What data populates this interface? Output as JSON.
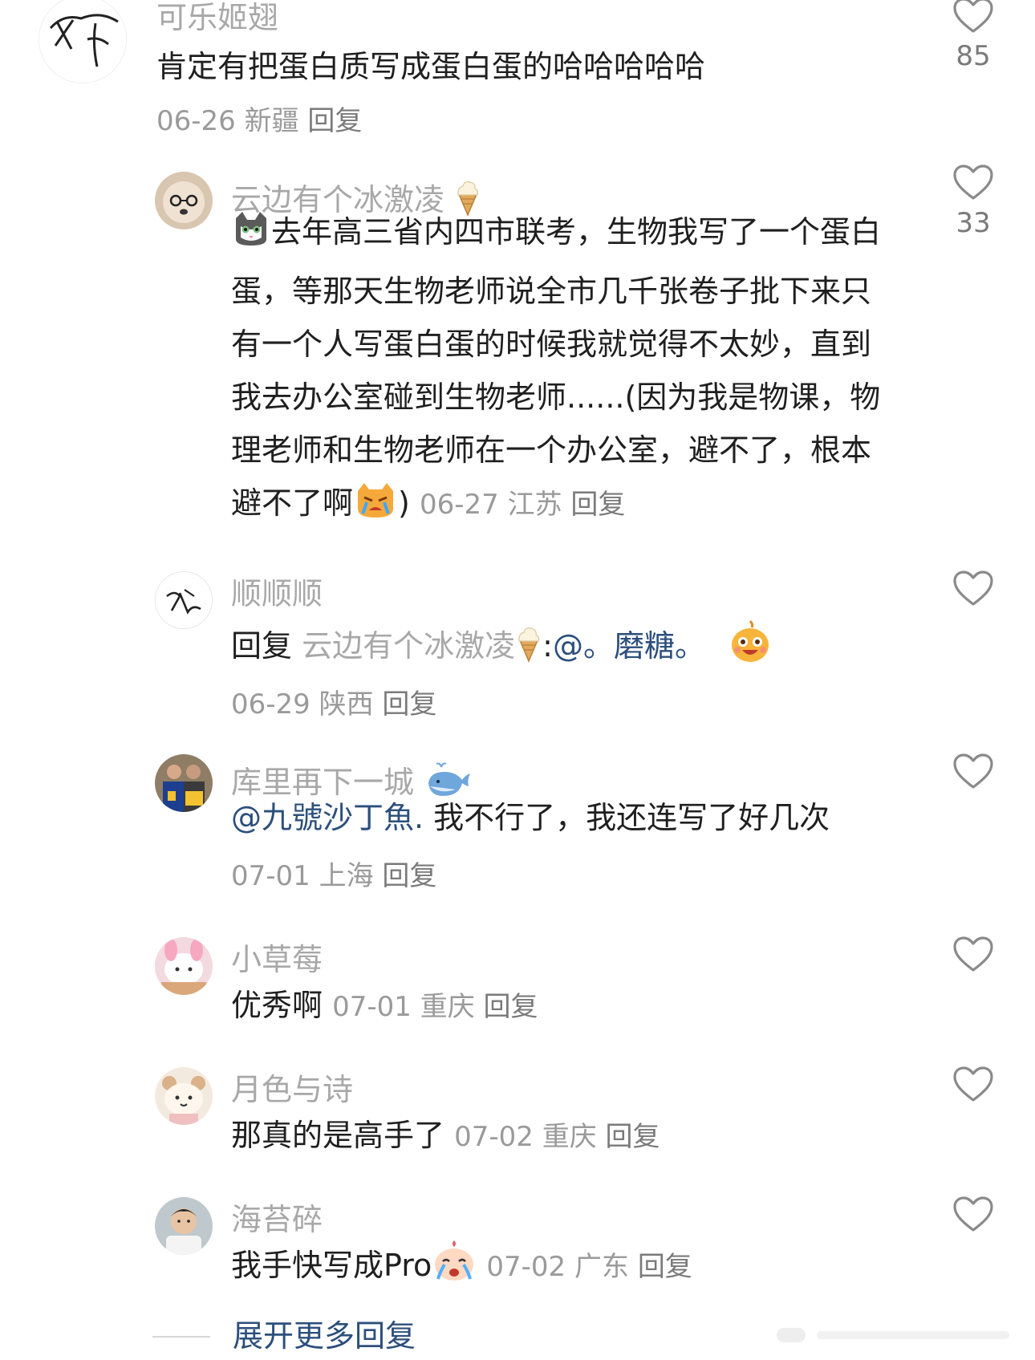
{
  "comments": [
    {
      "author": "可乐姬翅",
      "text": "肯定有把蛋白质写成蛋白蛋的哈哈哈哈哈",
      "date": "06-26",
      "location": "新疆",
      "reply_label": "回复",
      "likes": "85",
      "avatar_icon": "scribble-drawing-avatar-icon"
    },
    {
      "author": "云边有个冰激凌",
      "author_badge_icon": "ice-cream-icon",
      "lead_emoji": "cat-face-emoji",
      "text": "去年高三省内四市联考，生物我写了一个蛋白蛋，等那天生物老师说全市几千张卷子批下来只有一个人写蛋白蛋的时候我就觉得不太妙，直到我去办公室碰到生物老师......(因为我是物课，物理老师和生物老师在一个办公室，避不了，根本避不了啊",
      "text_tail": ")",
      "tail_emoji": "angry-cat-crying-emoji",
      "date": "06-27",
      "location": "江苏",
      "reply_label": "回复",
      "likes": "33",
      "avatar_icon": "puppy-with-glasses-avatar-icon"
    },
    {
      "author": "顺顺顺",
      "text_prefix": "回复",
      "reply_to": "云边有个冰激凌",
      "reply_to_badge_icon": "ice-cream-icon",
      "separator": ":",
      "mention": "@。磨糖。",
      "tail_emoji": "laughing-face-emoji",
      "date": "06-29",
      "location": "陕西",
      "reply_label": "回复",
      "avatar_icon": "calligraphy-signature-avatar-icon"
    },
    {
      "author": "库里再下一城",
      "author_badge_icon": "whale-icon",
      "mention": "@九號沙丁魚.",
      "text": " 我不行了，我还连写了好几次",
      "date": "07-01",
      "location": "上海",
      "reply_label": "回复",
      "avatar_icon": "basketball-players-avatar-icon"
    },
    {
      "author": "小草莓",
      "text": "优秀啊",
      "date": "07-01",
      "location": "重庆",
      "reply_label": "回复",
      "avatar_icon": "pink-bunny-avatar-icon"
    },
    {
      "author": "月色与诗",
      "text": "那真的是高手了",
      "date": "07-02",
      "location": "重庆",
      "reply_label": "回复",
      "avatar_icon": "cute-bear-avatar-icon"
    },
    {
      "author": "海苔碎",
      "text": "我手快写成Pro",
      "tail_emoji": "crying-baby-face-emoji",
      "date": "07-02",
      "location": "广东",
      "reply_label": "回复",
      "avatar_icon": "boy-photo-avatar-icon"
    }
  ],
  "expand_more_label": "展开更多回复",
  "colors": {
    "text": "#1f1f1f",
    "name": "#a8a8a8",
    "meta": "#9a9a9a",
    "link": "#2c4f7c",
    "heart": "#8a8a8a"
  }
}
